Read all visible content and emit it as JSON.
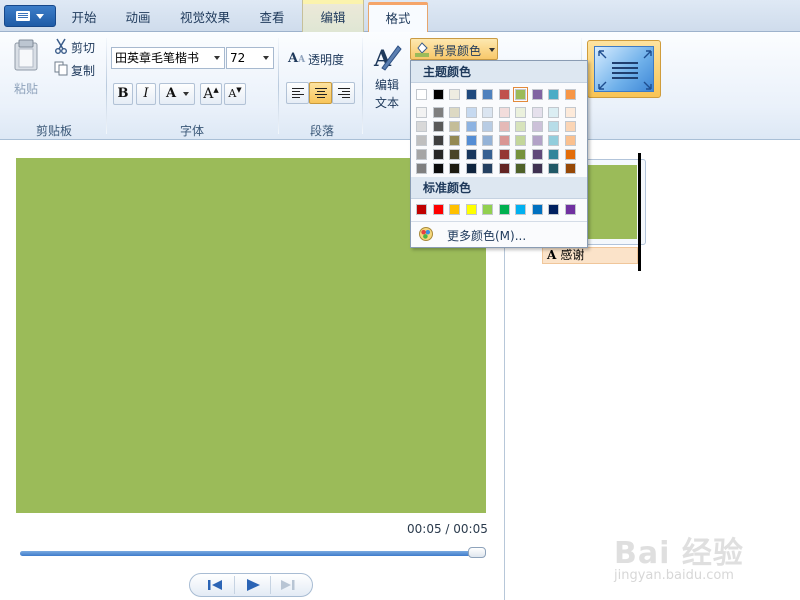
{
  "tabs": [
    {
      "label": "开始"
    },
    {
      "label": "动画"
    },
    {
      "label": "视觉效果"
    },
    {
      "label": "查看"
    },
    {
      "label": "编辑"
    },
    {
      "label": "格式"
    }
  ],
  "ribbon": {
    "clipboard": {
      "paste": "粘贴",
      "cut": "剪切",
      "copy": "复制",
      "group": "剪贴板"
    },
    "font": {
      "family": "田英章毛笔楷书",
      "size": "72",
      "bold": "B",
      "italic": "I",
      "color": "A",
      "grow": "A",
      "shrink": "A",
      "group": "字体"
    },
    "paragraph": {
      "transparency": "透明度",
      "group": "段落"
    },
    "edit_text": {
      "line1": "编辑",
      "line2": "文本"
    },
    "bg_color": {
      "label": "背景颜色"
    }
  },
  "color_menu": {
    "theme_title": "主题颜色",
    "standard_title": "标准颜色",
    "more": "更多颜色(M)...",
    "theme_top": [
      "#ffffff",
      "#000000",
      "#eeece1",
      "#1f497d",
      "#4f81bd",
      "#c0504d",
      "#9bbb59",
      "#8064a2",
      "#4bacc6",
      "#f79646"
    ],
    "theme_shades": [
      [
        "#f2f2f2",
        "#d8d8d8",
        "#bfbfbf",
        "#a5a5a5",
        "#7f7f7f"
      ],
      [
        "#7f7f7f",
        "#595959",
        "#3f3f3f",
        "#262626",
        "#0c0c0c"
      ],
      [
        "#ddd9c3",
        "#c4bd97",
        "#938953",
        "#494429",
        "#1d1b10"
      ],
      [
        "#c6d9f0",
        "#8db3e2",
        "#548dd4",
        "#17365d",
        "#0f243e"
      ],
      [
        "#dbe5f1",
        "#b8cce4",
        "#95b3d7",
        "#366092",
        "#244061"
      ],
      [
        "#f2dcdb",
        "#e5b9b7",
        "#d99694",
        "#953734",
        "#632423"
      ],
      [
        "#ebf1dd",
        "#d7e3bc",
        "#c3d69b",
        "#76923c",
        "#4f6128"
      ],
      [
        "#e5e0ec",
        "#ccc1d9",
        "#b2a2c7",
        "#5f497a",
        "#3f3151"
      ],
      [
        "#dbeef3",
        "#b7dde8",
        "#92cddc",
        "#31859b",
        "#205867"
      ],
      [
        "#fdeada",
        "#fbd5b5",
        "#fac08f",
        "#e36c09",
        "#974806"
      ]
    ],
    "standard": [
      "#c00000",
      "#ff0000",
      "#ffc000",
      "#ffff00",
      "#92d050",
      "#00b050",
      "#00b0f0",
      "#0070c0",
      "#002060",
      "#7030a0"
    ],
    "selected_index": 6
  },
  "preview": {
    "time": "00:05 / 00:05",
    "progress": 1.0,
    "frame_color": "#9bbb59"
  },
  "storyboard": {
    "caption_icon": "A",
    "caption": "感谢"
  },
  "watermark": {
    "logo": "Bai 经验",
    "site": "jingyan.baidu.com"
  }
}
